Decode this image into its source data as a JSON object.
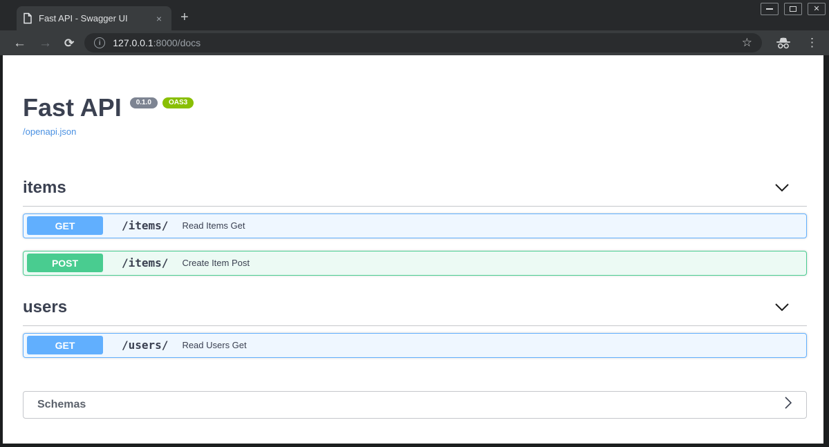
{
  "browser": {
    "tab_title": "Fast API - Swagger UI",
    "tab_close": "×",
    "new_tab": "+",
    "window_controls": [
      "minimize",
      "maximize",
      "close"
    ],
    "window_close_glyph": "✕",
    "toolbar": {
      "back": "←",
      "forward": "→",
      "reload": "⟳",
      "info": "i",
      "url_host": "127.0.0.1",
      "url_path": ":8000/docs",
      "star": "☆",
      "menu": "⋮"
    }
  },
  "page": {
    "title": "Fast API",
    "version_badge": "0.1.0",
    "oas_badge": "OAS3",
    "spec_link": "/openapi.json",
    "sections": [
      {
        "title": "items",
        "operations": [
          {
            "method": "GET",
            "path": "/items/",
            "summary": "Read Items Get"
          },
          {
            "method": "POST",
            "path": "/items/",
            "summary": "Create Item Post"
          }
        ]
      },
      {
        "title": "users",
        "operations": [
          {
            "method": "GET",
            "path": "/users/",
            "summary": "Read Users Get"
          }
        ]
      }
    ],
    "schemas_label": "Schemas"
  },
  "colors": {
    "get_method": "#61affe",
    "post_method": "#49cc90",
    "link": "#4990e2",
    "version_badge_bg": "#7d8492",
    "oas_badge_bg": "#89bf04",
    "heading_text": "#3b4151"
  }
}
